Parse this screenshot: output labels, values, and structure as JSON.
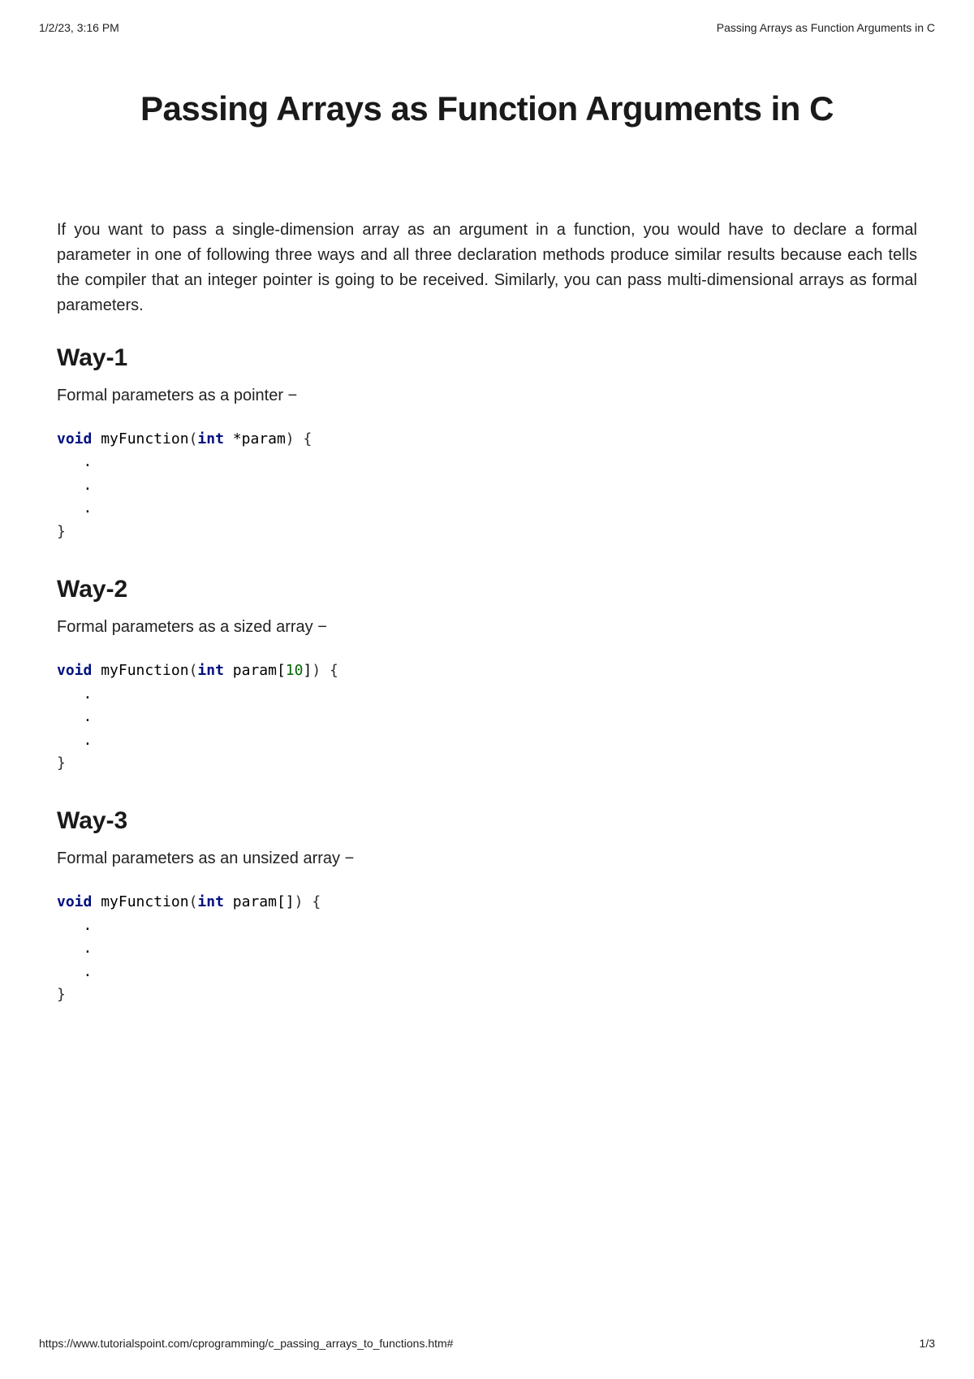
{
  "header": {
    "timestamp": "1/2/23, 3:16 PM",
    "doc_title": "Passing Arrays as Function Arguments in C"
  },
  "footer": {
    "url": "https://www.tutorialspoint.com/cprogramming/c_passing_arrays_to_functions.htm#",
    "page_num": "1/3"
  },
  "title": "Passing Arrays as Function Arguments in C",
  "intro": "If you want to pass a single-dimension array as an argument in a function, you would have to declare a formal parameter in one of following three ways and all three declaration methods produce similar results because each tells the compiler that an integer pointer is going to be received. Similarly, you can pass multi-dimensional arrays as formal parameters.",
  "ways": [
    {
      "heading": "Way-1",
      "desc": "Formal parameters as a pointer −",
      "code": {
        "kw_void": "void",
        "fn_name": " myFunction",
        "open_paren": "(",
        "kw_int": "int",
        "rest_sig": " *param",
        "close_sig": ") {",
        "body_dots": "   .\n   .\n   .",
        "close_brace": "}"
      }
    },
    {
      "heading": "Way-2",
      "desc": "Formal parameters as a sized array −",
      "code": {
        "kw_void": "void",
        "fn_name": " myFunction",
        "open_paren": "(",
        "kw_int": "int",
        "rest_sig_before_num": " param[",
        "num": "10",
        "rest_sig_after_num": "]",
        "close_sig": ") {",
        "body_dots": "   .\n   .\n   .",
        "close_brace": "}"
      }
    },
    {
      "heading": "Way-3",
      "desc": "Formal parameters as an unsized array −",
      "code": {
        "kw_void": "void",
        "fn_name": " myFunction",
        "open_paren": "(",
        "kw_int": "int",
        "rest_sig": " param[]",
        "close_sig": ") {",
        "body_dots": "   .\n   .\n   .",
        "close_brace": "}"
      }
    }
  ]
}
